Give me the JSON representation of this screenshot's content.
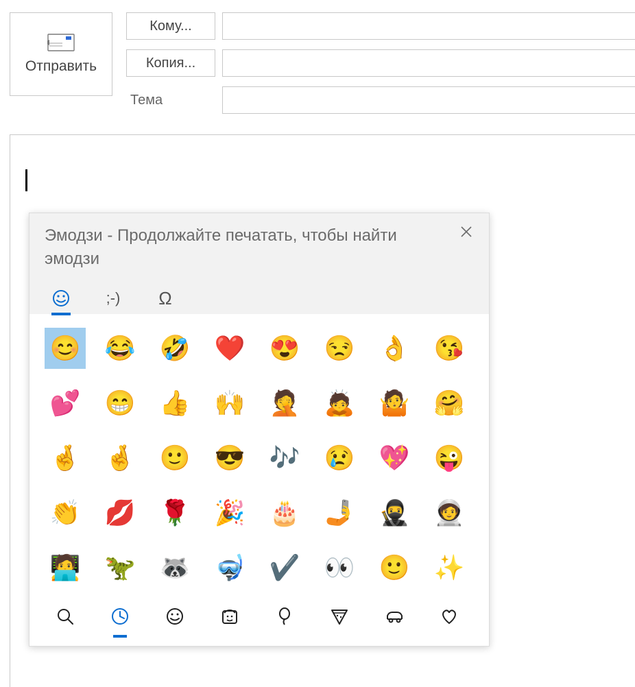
{
  "send_label": "Отправить",
  "to_label": "Кому...",
  "cc_label": "Копия...",
  "subject_label": "Тема",
  "emoji_panel": {
    "title": "Эмодзи - Продолжайте печатать, чтобы найти эмодзи",
    "tabs": {
      "kaomoji_label": ";-)",
      "symbols_label": "Ω"
    },
    "grid": [
      {
        "name": "smiling-face-blush",
        "char": "😊",
        "selected": true
      },
      {
        "name": "face-tears-joy",
        "char": "😂"
      },
      {
        "name": "rolling-on-floor-laughing",
        "char": "🤣"
      },
      {
        "name": "red-heart",
        "char": "❤️"
      },
      {
        "name": "smiling-face-heart-eyes",
        "char": "😍"
      },
      {
        "name": "unamused-face",
        "char": "😒"
      },
      {
        "name": "ok-hand",
        "char": "👌"
      },
      {
        "name": "face-blowing-kiss",
        "char": "😘"
      },
      {
        "name": "two-hearts",
        "char": "💕"
      },
      {
        "name": "beaming-face",
        "char": "😁"
      },
      {
        "name": "thumbs-up",
        "char": "👍"
      },
      {
        "name": "raising-hands",
        "char": "🙌"
      },
      {
        "name": "person-facepalming",
        "char": "🤦"
      },
      {
        "name": "person-bowing",
        "char": "🙇"
      },
      {
        "name": "person-shrugging",
        "char": "🤷"
      },
      {
        "name": "hugging-face",
        "char": "🤗"
      },
      {
        "name": "crossed-fingers",
        "char": "🤞"
      },
      {
        "name": "crossed-fingers-alt",
        "char": "🤞"
      },
      {
        "name": "slightly-smiling-face",
        "char": "🙂"
      },
      {
        "name": "smiling-face-sunglasses",
        "char": "😎"
      },
      {
        "name": "musical-notes",
        "char": "🎶"
      },
      {
        "name": "crying-face",
        "char": "😢"
      },
      {
        "name": "sparkling-heart",
        "char": "💖"
      },
      {
        "name": "winking-face-tongue",
        "char": "😜"
      },
      {
        "name": "clapping-hands",
        "char": "👏"
      },
      {
        "name": "kiss-mark",
        "char": "💋"
      },
      {
        "name": "rose",
        "char": "🌹"
      },
      {
        "name": "party-popper",
        "char": "🎉"
      },
      {
        "name": "birthday-cake",
        "char": "🎂"
      },
      {
        "name": "selfie",
        "char": "🤳"
      },
      {
        "name": "ninja",
        "char": "🥷"
      },
      {
        "name": "astronaut",
        "char": "🧑‍🚀"
      },
      {
        "name": "technologist",
        "char": "🧑‍💻"
      },
      {
        "name": "t-rex",
        "char": "🦖"
      },
      {
        "name": "raccoon",
        "char": "🦝"
      },
      {
        "name": "scuba-diver",
        "char": "🤿"
      },
      {
        "name": "check-mark",
        "char": "✔️"
      },
      {
        "name": "eyes",
        "char": "👀"
      },
      {
        "name": "slightly-smiling-face-2",
        "char": "🙂"
      },
      {
        "name": "sparkles",
        "char": "✨"
      }
    ],
    "categories": [
      {
        "name": "search",
        "active": false
      },
      {
        "name": "recent",
        "active": true
      },
      {
        "name": "smileys",
        "active": false
      },
      {
        "name": "people",
        "active": false
      },
      {
        "name": "celebration",
        "active": false
      },
      {
        "name": "food",
        "active": false
      },
      {
        "name": "transport",
        "active": false
      },
      {
        "name": "hearts",
        "active": false
      }
    ]
  }
}
